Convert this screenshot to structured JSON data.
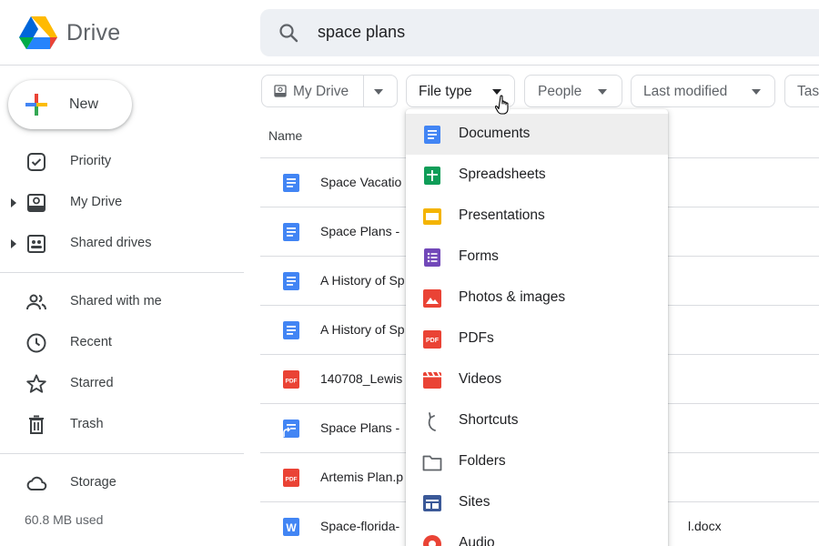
{
  "app": {
    "logo_text": "Drive"
  },
  "search": {
    "value": "space plans"
  },
  "sidebar": {
    "new_label": "New",
    "items": [
      {
        "label": "Priority",
        "icon": "priority-icon"
      },
      {
        "label": "My Drive",
        "icon": "my-drive-icon"
      },
      {
        "label": "Shared drives",
        "icon": "shared-drives-icon"
      },
      {
        "label": "Shared with me",
        "icon": "shared-with-me-icon"
      },
      {
        "label": "Recent",
        "icon": "clock-icon"
      },
      {
        "label": "Starred",
        "icon": "star-icon"
      },
      {
        "label": "Trash",
        "icon": "trash-icon"
      },
      {
        "label": "Storage",
        "icon": "cloud-icon"
      }
    ],
    "storage_used": "60.8 MB used"
  },
  "filters": [
    {
      "label": "My Drive"
    },
    {
      "label": "File type"
    },
    {
      "label": "People"
    },
    {
      "label": "Last modified"
    },
    {
      "label": "Tas"
    }
  ],
  "list": {
    "column_name": "Name",
    "rows": [
      {
        "name": "Space Vacatio",
        "type": "doc"
      },
      {
        "name": "Space Plans -",
        "type": "doc"
      },
      {
        "name": "A History of Sp",
        "type": "doc"
      },
      {
        "name": "A History of Sp",
        "type": "doc"
      },
      {
        "name": "140708_Lewis",
        "type": "pdf"
      },
      {
        "name": "Space Plans -",
        "type": "doc-shortcut"
      },
      {
        "name": "Artemis Plan.p",
        "type": "pdf"
      },
      {
        "name": "Space-florida-",
        "tail": "l.docx",
        "type": "word"
      }
    ]
  },
  "file_type_menu": {
    "items": [
      {
        "label": "Documents",
        "icon": "documents-icon",
        "color": "#4285f4"
      },
      {
        "label": "Spreadsheets",
        "icon": "spreadsheets-icon",
        "color": "#0f9d58"
      },
      {
        "label": "Presentations",
        "icon": "presentations-icon",
        "color": "#f4b400"
      },
      {
        "label": "Forms",
        "icon": "forms-icon",
        "color": "#7248b9"
      },
      {
        "label": "Photos & images",
        "icon": "photos-icon",
        "color": "#ea4335"
      },
      {
        "label": "PDFs",
        "icon": "pdf-icon",
        "color": "#ea4335"
      },
      {
        "label": "Videos",
        "icon": "videos-icon",
        "color": "#ea4335"
      },
      {
        "label": "Shortcuts",
        "icon": "shortcut-icon",
        "color": "#5f6368"
      },
      {
        "label": "Folders",
        "icon": "folder-icon",
        "color": "#5f6368"
      },
      {
        "label": "Sites",
        "icon": "sites-icon",
        "color": "#3b5998"
      },
      {
        "label": "Audio",
        "icon": "audio-icon",
        "color": "#ea4335"
      }
    ]
  }
}
